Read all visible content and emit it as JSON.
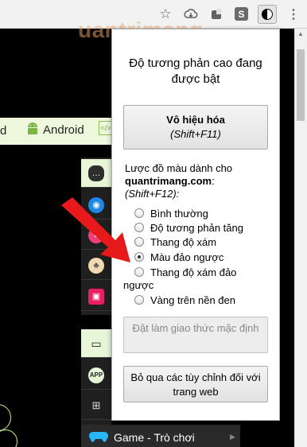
{
  "toolbar": {
    "icons": [
      "star-icon",
      "cloud-download-icon",
      "doc-extension-icon",
      "s-extension-icon",
      "high-contrast-icon",
      "menu-icon"
    ],
    "s_ext_label": "S"
  },
  "watermark": "uantrimang",
  "page": {
    "nav_partial": "d",
    "nav_android": "Android",
    "sidebar_game": "Game - Trò chơi"
  },
  "popup": {
    "title": "Độ tương phản cao đang được bật",
    "disable_button": {
      "label": "Vô hiệu hóa",
      "shortcut": "(Shift+F11)"
    },
    "scheme_prefix": "Lược đồ màu dành cho",
    "scheme_site": "quantrimang.com",
    "scheme_suffix": ":",
    "scheme_shortcut": "(Shift+F12):",
    "options": [
      "Bình thường",
      "Độ tương phản tăng",
      "Thang độ xám",
      "Màu đảo ngược",
      "Thang độ xám đảo ngược",
      "Vàng trên nền đen"
    ],
    "selected_option": "Màu đảo ngược",
    "default_button": "Đặt làm giao thức mặc định",
    "skip_button": "Bỏ qua các tùy chỉnh đối với trang web"
  },
  "colors": {
    "arrow": "#e8191a",
    "green_strip": "#eef8dc"
  }
}
